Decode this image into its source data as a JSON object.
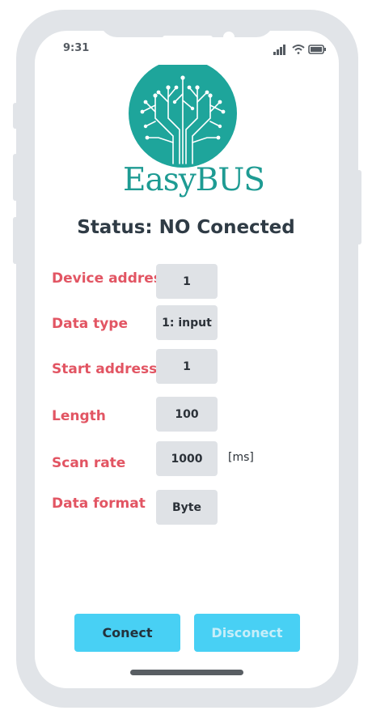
{
  "status_bar": {
    "time": "9:31",
    "icons": [
      "signal-icon",
      "wifi-icon",
      "battery-icon"
    ]
  },
  "brand": {
    "name": "EasyBUS",
    "color": "#1e9b93"
  },
  "status": {
    "text": "Status: NO Conected"
  },
  "form": {
    "fields": [
      {
        "label": "Device address",
        "value": "1"
      },
      {
        "label": "Data type",
        "value": "1: input"
      },
      {
        "label": "Start address",
        "value": "1"
      },
      {
        "label": "Length",
        "value": "100"
      },
      {
        "label": "Scan rate",
        "value": "1000",
        "unit": "[ms]"
      },
      {
        "label": "Data format",
        "value": "Byte"
      }
    ]
  },
  "actions": {
    "connect_label": "Conect",
    "disconnect_label": "Disconect"
  },
  "colors": {
    "label": "#e25563",
    "button": "#48d0f4",
    "field": "#dfe2e6",
    "frame": "#e1e4e8"
  }
}
